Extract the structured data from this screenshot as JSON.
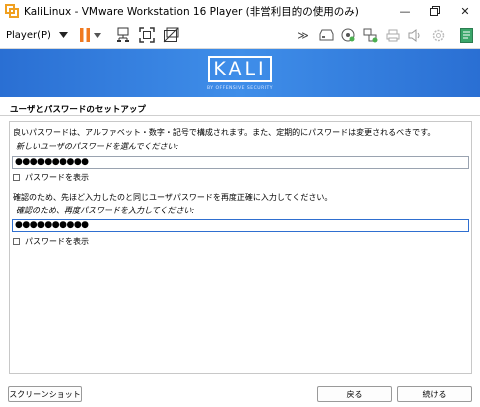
{
  "window": {
    "title": "KaliLinux - VMware Workstation 16 Player (非営利目的の使用のみ)"
  },
  "toolbar": {
    "player_label": "Player(P)"
  },
  "banner": {
    "logo_text": "KALI",
    "logo_subtext": "BY OFFENSIVE SECURITY"
  },
  "installer": {
    "heading": "ユーザとパスワードのセットアップ",
    "description": "良いパスワードは、アルファベット・数字・記号で構成されます。また、定期的にパスワードは変更されるべきです。",
    "new_password_prompt": "新しいユーザのパスワードを選んでください:",
    "password_value": "●●●●●●●●●●",
    "show_password_label_1": "パスワードを表示",
    "confirm_description": "確認のため、先ほど入力したのと同じユーザパスワードを再度正確に入力してください。",
    "confirm_prompt": "確認のため、再度パスワードを入力してください:",
    "confirm_value": "●●●●●●●●●●",
    "show_password_label_2": "パスワードを表示"
  },
  "buttons": {
    "screenshot": "スクリーンショット",
    "back": "戻る",
    "continue": "続ける"
  },
  "colors": {
    "banner_blue": "#3f8ee9",
    "pause_orange": "#f07a21",
    "focus_blue": "#2f6fd0"
  }
}
